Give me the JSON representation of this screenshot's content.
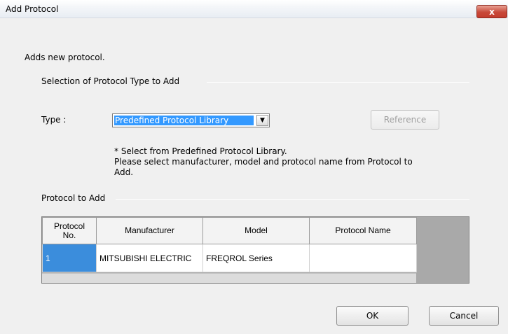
{
  "window": {
    "title": "Add Protocol",
    "close_glyph": "x"
  },
  "dialog": {
    "description": "Adds new protocol.",
    "selection_group_label": "Selection of Protocol Type to Add",
    "type_label": "Type :",
    "type_value": "Predefined Protocol Library",
    "reference_button": "Reference",
    "note_line1": "* Select from Predefined Protocol Library.",
    "note_line2": "Please select manufacturer, model and protocol name from Protocol to",
    "note_line3": "Add.",
    "protocol_group_label": "Protocol to Add"
  },
  "table": {
    "headers": {
      "no_line1": "Protocol",
      "no_line2": "No.",
      "manufacturer": "Manufacturer",
      "model": "Model",
      "protocol_name": "Protocol Name"
    },
    "rows": [
      {
        "no": "1",
        "manufacturer": "MITSUBISHI ELECTRIC",
        "model": "FREQROL Series",
        "protocol_name": ""
      }
    ]
  },
  "buttons": {
    "ok": "OK",
    "cancel": "Cancel"
  },
  "colors": {
    "selection": "#3399ff",
    "row_selected": "#3b8ddc",
    "close_button": "#c8493a"
  }
}
